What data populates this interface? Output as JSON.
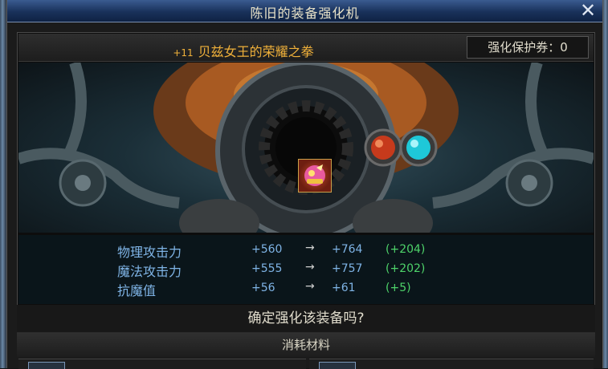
{
  "window": {
    "title": "陈旧的装备强化机",
    "close_glyph": "✕"
  },
  "item": {
    "enhance_level": "+11",
    "name": "贝兹女王的荣耀之拳",
    "name_color": "#f0b13a"
  },
  "protection": {
    "label": "强化保护券：0"
  },
  "stats": [
    {
      "label": "物理攻击力",
      "old": "+560",
      "arrow": "→",
      "new": "+764",
      "diff": "(+204)"
    },
    {
      "label": "魔法攻击力",
      "old": "+555",
      "arrow": "→",
      "new": "+757",
      "diff": "(+202)"
    },
    {
      "label": "抗魔值",
      "old": "+56",
      "arrow": "→",
      "new": "+61",
      "diff": "(+5)"
    }
  ],
  "confirm": {
    "question": "确定强化该装备吗?"
  },
  "materials": {
    "title": "消耗材料"
  },
  "colors": {
    "stat_text": "#7fb4e6",
    "diff_text": "#4ed36a",
    "title_bar": "#19315a"
  }
}
